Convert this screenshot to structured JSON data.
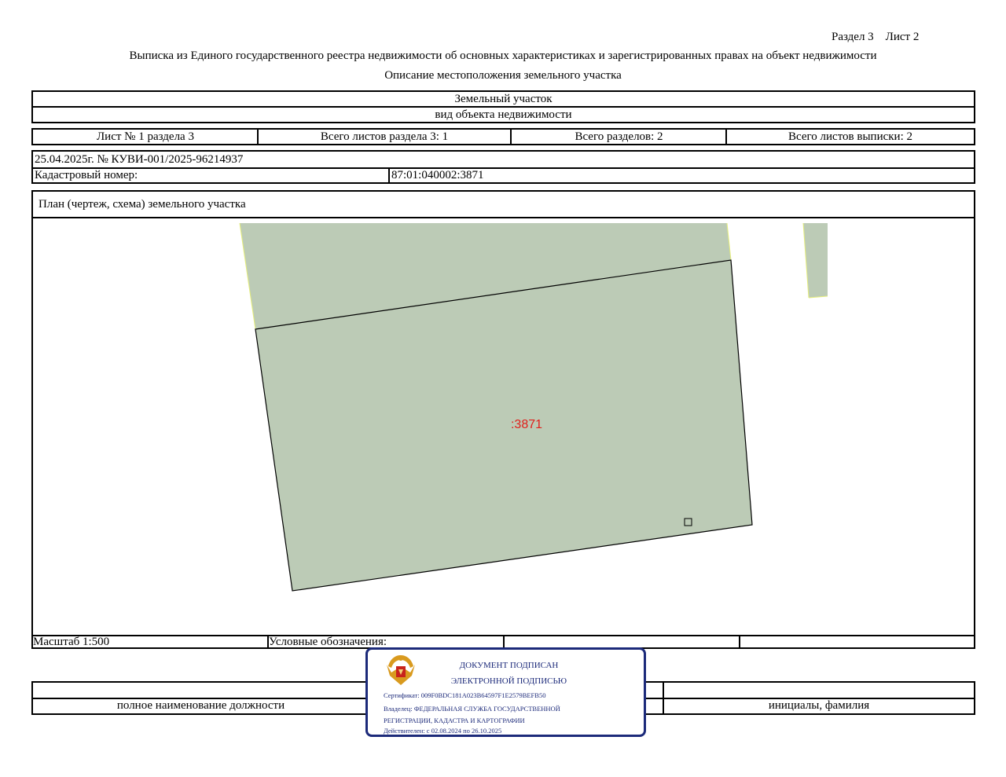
{
  "header": {
    "section_sheet": "Раздел 3    Лист 2",
    "title": "Выписка из Единого государственного реестра недвижимости об основных характеристиках и зарегистрированных правах на объект недвижимости",
    "subtitle": "Описание местоположения земельного участка"
  },
  "object": {
    "type": "Земельный участок",
    "type_caption": "вид объекта недвижимости"
  },
  "sheets": {
    "sheet_of_section": "Лист № 1 раздела 3",
    "total_sheets_section": "Всего листов раздела 3: 1",
    "total_sections": "Всего разделов: 2",
    "total_sheets_extract": "Всего листов выписки: 2"
  },
  "record": {
    "date_number": "25.04.2025г. № КУВИ-001/2025-96214937",
    "cadastral_label": "Кадастровый номер:",
    "cadastral_value": "87:01:040002:3871"
  },
  "plan": {
    "title": "План (чертеж, схема) земельного участка",
    "parcel_label": ":3871",
    "colors": {
      "fill": "#bccbb6",
      "label": "#e0201c",
      "edge": "#e6ee7a"
    }
  },
  "footer": {
    "scale": "Масштаб 1:500",
    "legend": "Условные обозначения:",
    "position_caption": "полное наименование должности",
    "initials_caption": "инициалы, фамилия"
  },
  "stamp": {
    "line1": "ДОКУМЕНТ ПОДПИСАН",
    "line2": "ЭЛЕКТРОННОЙ ПОДПИСЬЮ",
    "certificate": "Сертификат: 009F0BDC181A023B64597F1E2579BEFB50",
    "owner1": "Владелец: ФЕДЕРАЛЬНАЯ СЛУЖБА ГОСУДАРСТВЕННОЙ",
    "owner2": "РЕГИСТРАЦИИ, КАДАСТРА И КАРТОГРАФИИ",
    "validity": "Действителен: с 02.08.2024 по 26.10.2025",
    "border_color": "#1c2a7a",
    "emblem": "coat-of-arms"
  }
}
